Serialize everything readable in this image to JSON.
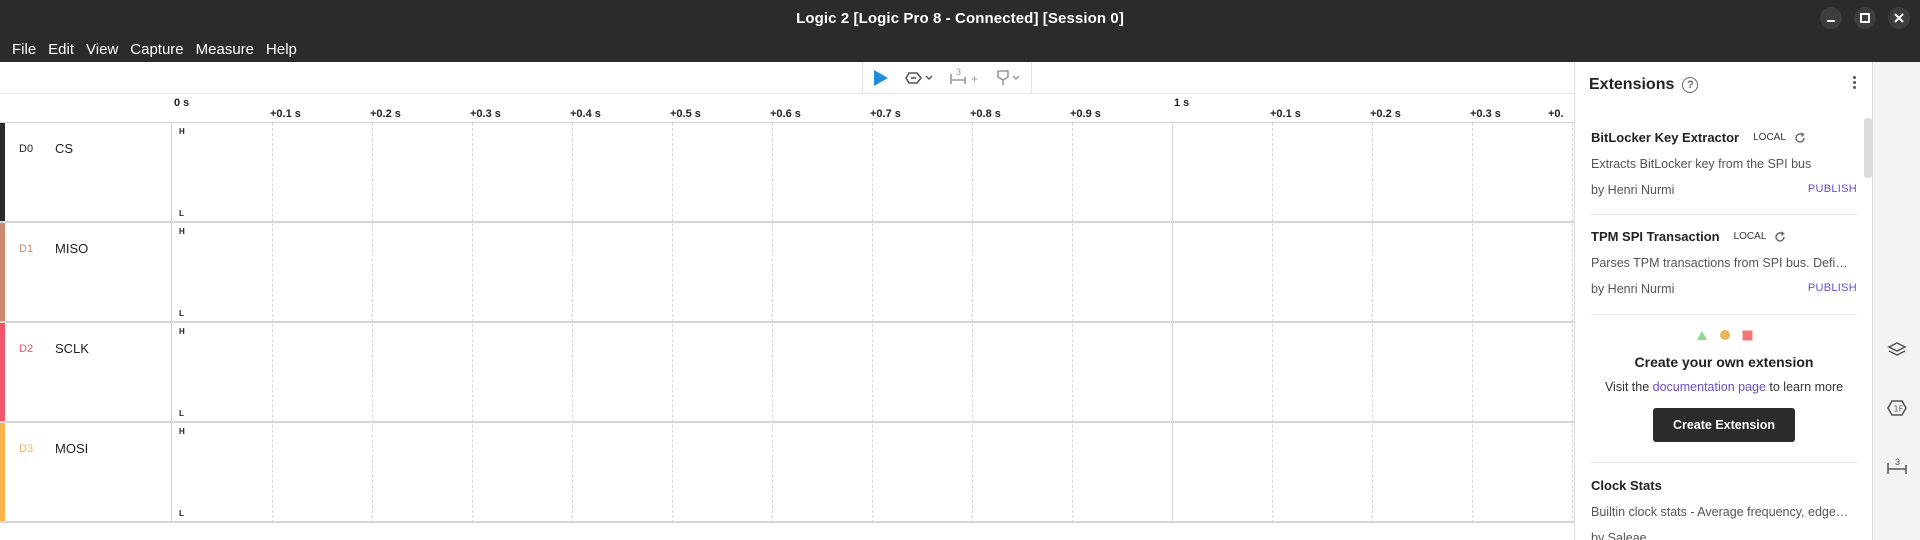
{
  "window": {
    "title": "Logic 2 [Logic Pro 8 - Connected] [Session 0]"
  },
  "menu": [
    "File",
    "Edit",
    "View",
    "Capture",
    "Measure",
    "Help"
  ],
  "toolbar": {
    "marker_count": "3",
    "marker_plus": "+"
  },
  "ruler": {
    "major": [
      "0 s",
      "1 s"
    ],
    "minor_first": [
      "+0.1 s",
      "+0.2 s",
      "+0.3 s",
      "+0.4 s",
      "+0.5 s",
      "+0.6 s",
      "+0.7 s",
      "+0.8 s",
      "+0.9 s"
    ],
    "minor_second": [
      "+0.1 s",
      "+0.2 s",
      "+0.3 s",
      "+0."
    ]
  },
  "channels": [
    {
      "id": "D0",
      "name": "CS",
      "color": "#2b2b2b",
      "high": "H",
      "low": "L"
    },
    {
      "id": "D1",
      "name": "MISO",
      "color": "#c98a6f",
      "high": "H",
      "low": "L"
    },
    {
      "id": "D2",
      "name": "SCLK",
      "color": "#f2566b",
      "high": "H",
      "low": "L"
    },
    {
      "id": "D3",
      "name": "MOSI",
      "color": "#f6b34c",
      "high": "H",
      "low": "L"
    }
  ],
  "extensions_panel": {
    "title": "Extensions",
    "help": "?",
    "items": [
      {
        "name": "BitLocker Key Extractor",
        "badge": "LOCAL",
        "description": "Extracts BitLocker key from the SPI bus",
        "author": "by Henri Nurmi",
        "action": "PUBLISH"
      },
      {
        "name": "TPM SPI Transaction",
        "badge": "LOCAL",
        "description": "Parses TPM transactions from SPI bus. Defi…",
        "author": "by Henri Nurmi",
        "action": "PUBLISH"
      }
    ],
    "create": {
      "title": "Create your own extension",
      "text_before": "Visit the ",
      "link": "documentation page",
      "text_after": " to learn more",
      "button": "Create Extension"
    },
    "builtin": {
      "name": "Clock Stats",
      "description": "Builtin clock stats - Average frequency, edge…",
      "author": "by Saleae"
    }
  },
  "sidebar": {
    "measure_badge": "3"
  },
  "colors": {
    "accent": "#1e8fd8",
    "link": "#6a4fc7",
    "dark": "#2b2b2b"
  }
}
